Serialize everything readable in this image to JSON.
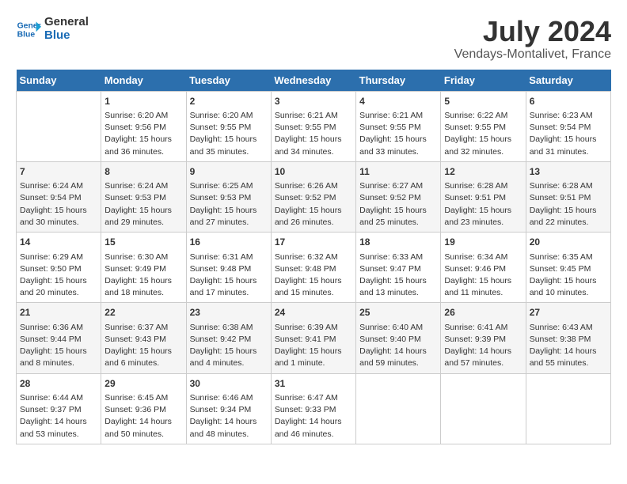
{
  "logo": {
    "line1": "General",
    "line2": "Blue"
  },
  "title": "July 2024",
  "location": "Vendays-Montalivet, France",
  "days_of_week": [
    "Sunday",
    "Monday",
    "Tuesday",
    "Wednesday",
    "Thursday",
    "Friday",
    "Saturday"
  ],
  "weeks": [
    [
      {
        "day": "",
        "info": ""
      },
      {
        "day": "1",
        "info": "Sunrise: 6:20 AM\nSunset: 9:56 PM\nDaylight: 15 hours\nand 36 minutes."
      },
      {
        "day": "2",
        "info": "Sunrise: 6:20 AM\nSunset: 9:55 PM\nDaylight: 15 hours\nand 35 minutes."
      },
      {
        "day": "3",
        "info": "Sunrise: 6:21 AM\nSunset: 9:55 PM\nDaylight: 15 hours\nand 34 minutes."
      },
      {
        "day": "4",
        "info": "Sunrise: 6:21 AM\nSunset: 9:55 PM\nDaylight: 15 hours\nand 33 minutes."
      },
      {
        "day": "5",
        "info": "Sunrise: 6:22 AM\nSunset: 9:55 PM\nDaylight: 15 hours\nand 32 minutes."
      },
      {
        "day": "6",
        "info": "Sunrise: 6:23 AM\nSunset: 9:54 PM\nDaylight: 15 hours\nand 31 minutes."
      }
    ],
    [
      {
        "day": "7",
        "info": "Sunrise: 6:24 AM\nSunset: 9:54 PM\nDaylight: 15 hours\nand 30 minutes."
      },
      {
        "day": "8",
        "info": "Sunrise: 6:24 AM\nSunset: 9:53 PM\nDaylight: 15 hours\nand 29 minutes."
      },
      {
        "day": "9",
        "info": "Sunrise: 6:25 AM\nSunset: 9:53 PM\nDaylight: 15 hours\nand 27 minutes."
      },
      {
        "day": "10",
        "info": "Sunrise: 6:26 AM\nSunset: 9:52 PM\nDaylight: 15 hours\nand 26 minutes."
      },
      {
        "day": "11",
        "info": "Sunrise: 6:27 AM\nSunset: 9:52 PM\nDaylight: 15 hours\nand 25 minutes."
      },
      {
        "day": "12",
        "info": "Sunrise: 6:28 AM\nSunset: 9:51 PM\nDaylight: 15 hours\nand 23 minutes."
      },
      {
        "day": "13",
        "info": "Sunrise: 6:28 AM\nSunset: 9:51 PM\nDaylight: 15 hours\nand 22 minutes."
      }
    ],
    [
      {
        "day": "14",
        "info": "Sunrise: 6:29 AM\nSunset: 9:50 PM\nDaylight: 15 hours\nand 20 minutes."
      },
      {
        "day": "15",
        "info": "Sunrise: 6:30 AM\nSunset: 9:49 PM\nDaylight: 15 hours\nand 18 minutes."
      },
      {
        "day": "16",
        "info": "Sunrise: 6:31 AM\nSunset: 9:48 PM\nDaylight: 15 hours\nand 17 minutes."
      },
      {
        "day": "17",
        "info": "Sunrise: 6:32 AM\nSunset: 9:48 PM\nDaylight: 15 hours\nand 15 minutes."
      },
      {
        "day": "18",
        "info": "Sunrise: 6:33 AM\nSunset: 9:47 PM\nDaylight: 15 hours\nand 13 minutes."
      },
      {
        "day": "19",
        "info": "Sunrise: 6:34 AM\nSunset: 9:46 PM\nDaylight: 15 hours\nand 11 minutes."
      },
      {
        "day": "20",
        "info": "Sunrise: 6:35 AM\nSunset: 9:45 PM\nDaylight: 15 hours\nand 10 minutes."
      }
    ],
    [
      {
        "day": "21",
        "info": "Sunrise: 6:36 AM\nSunset: 9:44 PM\nDaylight: 15 hours\nand 8 minutes."
      },
      {
        "day": "22",
        "info": "Sunrise: 6:37 AM\nSunset: 9:43 PM\nDaylight: 15 hours\nand 6 minutes."
      },
      {
        "day": "23",
        "info": "Sunrise: 6:38 AM\nSunset: 9:42 PM\nDaylight: 15 hours\nand 4 minutes."
      },
      {
        "day": "24",
        "info": "Sunrise: 6:39 AM\nSunset: 9:41 PM\nDaylight: 15 hours\nand 1 minute."
      },
      {
        "day": "25",
        "info": "Sunrise: 6:40 AM\nSunset: 9:40 PM\nDaylight: 14 hours\nand 59 minutes."
      },
      {
        "day": "26",
        "info": "Sunrise: 6:41 AM\nSunset: 9:39 PM\nDaylight: 14 hours\nand 57 minutes."
      },
      {
        "day": "27",
        "info": "Sunrise: 6:43 AM\nSunset: 9:38 PM\nDaylight: 14 hours\nand 55 minutes."
      }
    ],
    [
      {
        "day": "28",
        "info": "Sunrise: 6:44 AM\nSunset: 9:37 PM\nDaylight: 14 hours\nand 53 minutes."
      },
      {
        "day": "29",
        "info": "Sunrise: 6:45 AM\nSunset: 9:36 PM\nDaylight: 14 hours\nand 50 minutes."
      },
      {
        "day": "30",
        "info": "Sunrise: 6:46 AM\nSunset: 9:34 PM\nDaylight: 14 hours\nand 48 minutes."
      },
      {
        "day": "31",
        "info": "Sunrise: 6:47 AM\nSunset: 9:33 PM\nDaylight: 14 hours\nand 46 minutes."
      },
      {
        "day": "",
        "info": ""
      },
      {
        "day": "",
        "info": ""
      },
      {
        "day": "",
        "info": ""
      }
    ]
  ]
}
